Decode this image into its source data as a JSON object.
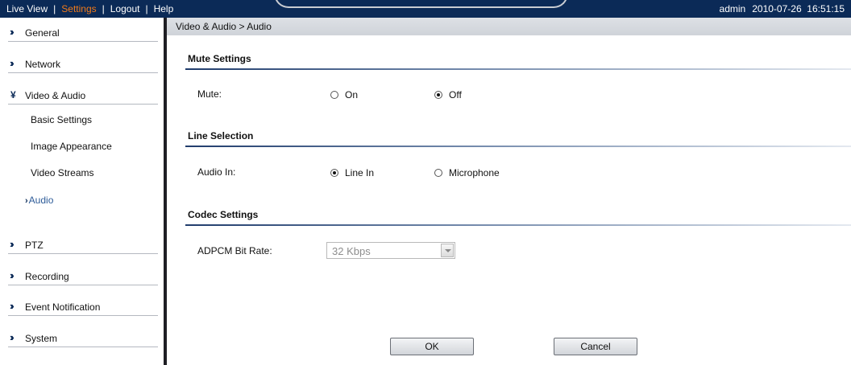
{
  "topbar": {
    "links": [
      "Live View",
      "Settings",
      "Logout",
      "Help"
    ],
    "separator": "|",
    "user": "admin",
    "datetime": "2010-07-26  16:51:15",
    "active_color": "#f07a1a",
    "bar_color": "#0b2a57"
  },
  "sidebar": {
    "chevron_icon": "double-chevron-right-icon",
    "expanded_icon": "double-chevron-down-icon",
    "items": [
      {
        "label": "General"
      },
      {
        "label": "Network"
      },
      {
        "label": "Video & Audio"
      },
      {
        "label": "PTZ"
      },
      {
        "label": "Recording"
      },
      {
        "label": "Event Notification"
      },
      {
        "label": "System"
      }
    ],
    "subitems": [
      "Basic Settings",
      "Image Appearance",
      "Video Streams"
    ],
    "active_subitem": "Audio"
  },
  "breadcrumb": "Video & Audio > Audio",
  "sections": {
    "mute": {
      "title": "Mute Settings",
      "label": "Mute:",
      "options": [
        "On",
        "Off"
      ],
      "selected": "Off"
    },
    "line": {
      "title": "Line Selection",
      "label": "Audio In:",
      "options": [
        "Line In",
        "Microphone"
      ],
      "selected": "Line In"
    },
    "codec": {
      "title": "Codec Settings",
      "label": "ADPCM Bit Rate:",
      "value": "32 Kbps"
    }
  },
  "buttons": {
    "ok": "OK",
    "cancel": "Cancel"
  }
}
